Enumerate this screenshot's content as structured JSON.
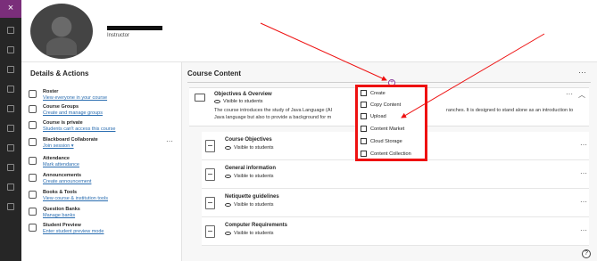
{
  "left_nav": {
    "close_label": "×"
  },
  "header": {
    "role": "Instructor"
  },
  "details": {
    "title": "Details & Actions",
    "items": [
      {
        "title": "Roster",
        "sub": "View everyone in your course"
      },
      {
        "title": "Course Groups",
        "sub": "Create and manage groups"
      },
      {
        "title": "Course is private",
        "sub": "Students can't access this course"
      },
      {
        "title": "Blackboard Collaborate",
        "sub": "Join session ▾"
      },
      {
        "title": "Attendance",
        "sub": "Mark attendance"
      },
      {
        "title": "Announcements",
        "sub": "Create announcement"
      },
      {
        "title": "Books & Tools",
        "sub": "View course & institution tools"
      },
      {
        "title": "Question Banks",
        "sub": "Manage banks"
      },
      {
        "title": "Student Preview",
        "sub": "Enter student preview mode"
      }
    ]
  },
  "content": {
    "title": "Course Content",
    "folder": {
      "title": "Objectives & Overview",
      "visibility": "Visible to students",
      "description_left": "The course introduces the study of Java Language (AI",
      "description_right": "ranches. It is designed to stand alone as an introduction to",
      "description_line2": "Java language but also to provide a background for m"
    },
    "children": [
      {
        "title": "Course Objectives",
        "visibility": "Visible to students"
      },
      {
        "title": "General information",
        "visibility": "Visible to students"
      },
      {
        "title": "Netiquette guidelines",
        "visibility": "Visible to students"
      },
      {
        "title": "Computer Requirements",
        "visibility": "Visible to students"
      }
    ]
  },
  "add_menu": {
    "items": [
      "Create",
      "Copy Content",
      "Upload",
      "Content Market",
      "Cloud Storage",
      "Content Collection"
    ]
  },
  "colors": {
    "accent": "#8a3f9a",
    "highlight": "#e11111",
    "link": "#2a6db0"
  }
}
